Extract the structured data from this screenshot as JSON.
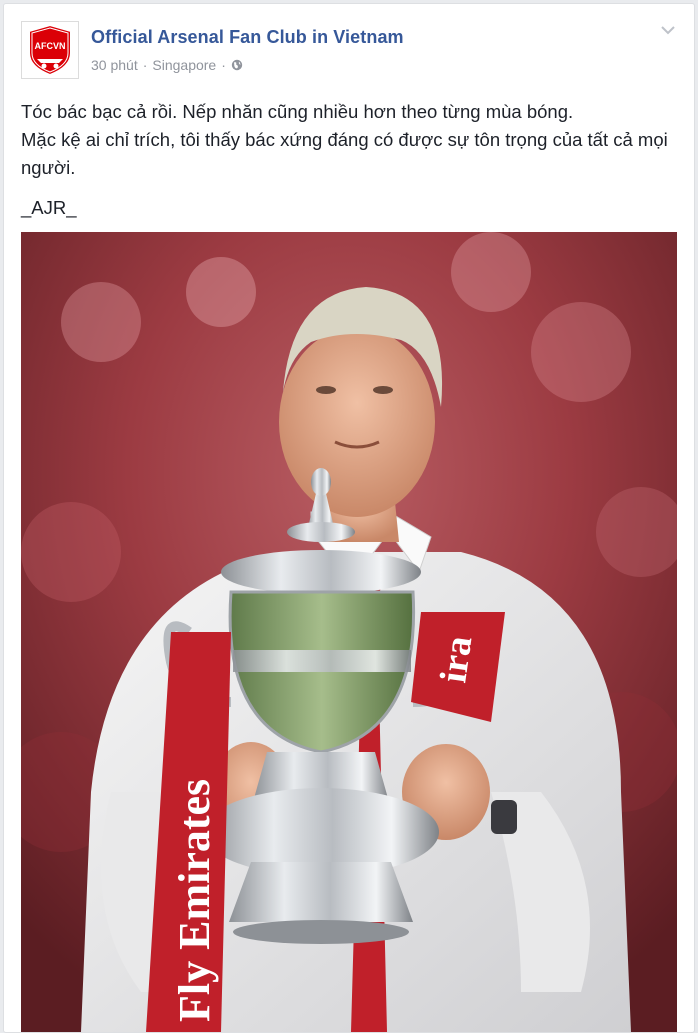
{
  "post": {
    "page_name": "Official Arsenal Fan Club in Vietnam",
    "time": "30 phút",
    "separator": "·",
    "location": "Singapore",
    "separator2": "·",
    "avatar_text": "AFCVN",
    "text_line1": "Tóc bác bạc cả rồi. Nếp nhăn cũng nhiều hơn theo từng mùa bóng.",
    "text_line2": "Mặc kệ ai chỉ trích, tôi thấy bác xứng đáng có được sự tôn trọng của tất cả mọi người.",
    "signature": "_AJR_",
    "photo": {
      "ribbon_left_text": "Fly Emirates",
      "ribbon_right_text": "ira"
    }
  },
  "colors": {
    "link": "#365899",
    "meta": "#90949c",
    "text": "#1d2129",
    "arsenal_red": "#db0007"
  },
  "icons": {
    "globe": "globe-icon",
    "chevron": "chevron-down-icon",
    "avatar": "arsenal-crest-icon"
  }
}
